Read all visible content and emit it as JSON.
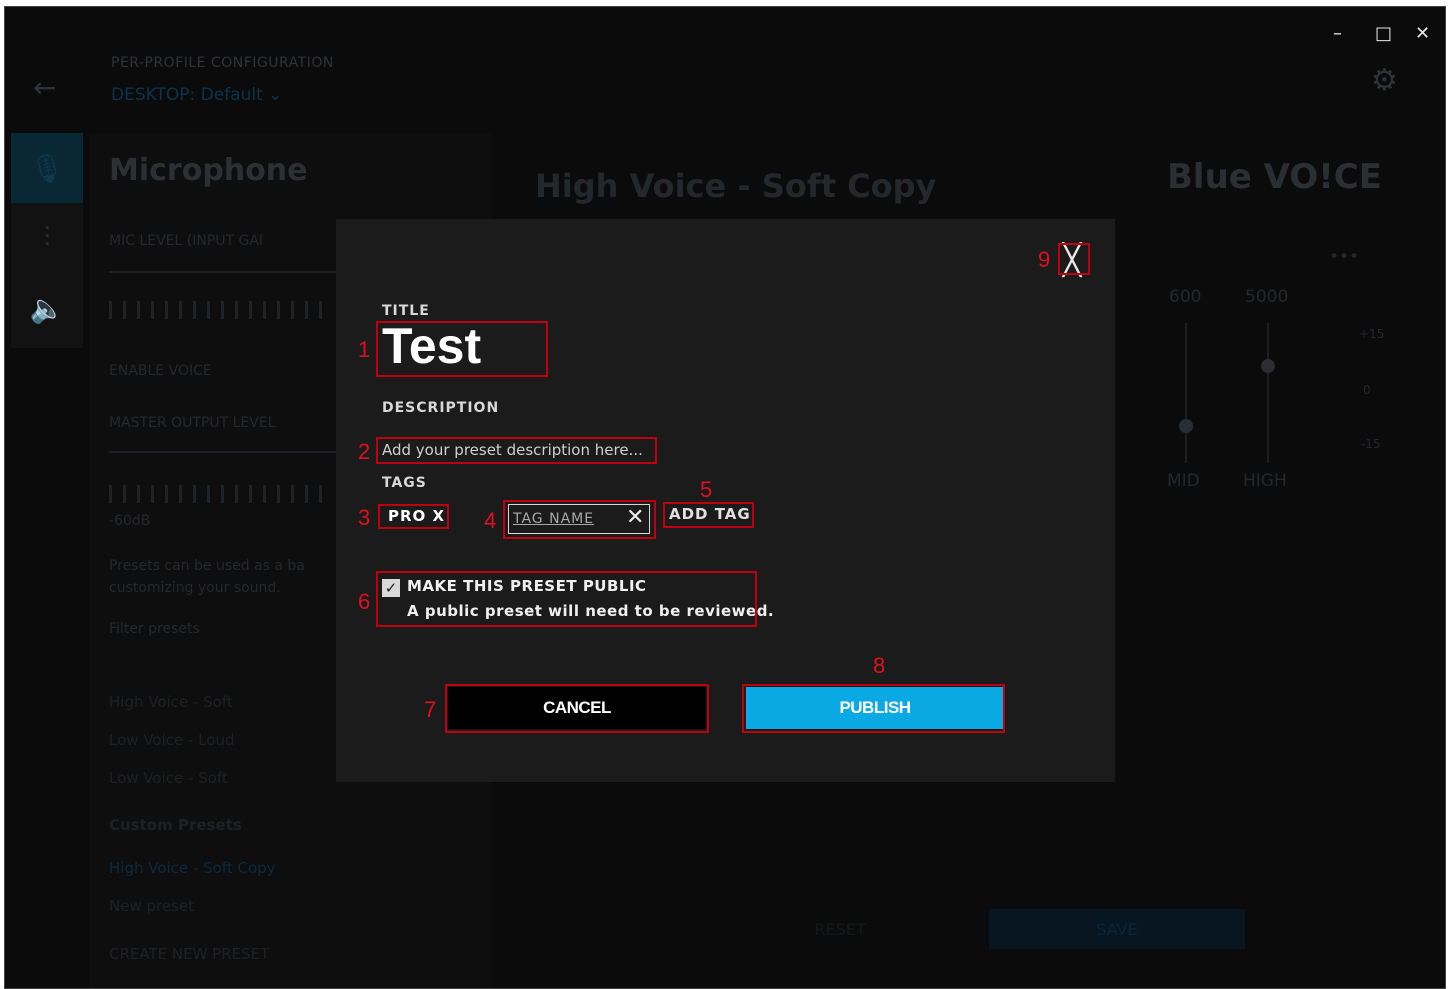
{
  "window": {
    "minimize_glyph": "–",
    "maximize_glyph": "□",
    "close_glyph": "✕"
  },
  "topbar": {
    "back_icon": "←",
    "config_label": "PER-PROFILE CONFIGURATION",
    "profile": "DESKTOP: Default",
    "profile_chevron": "⌄",
    "settings_icon": "⚙"
  },
  "rail": {
    "items": [
      {
        "icon": "mic-icon",
        "glyph": "🎙"
      },
      {
        "icon": "equalizer-icon",
        "glyph": "⫶"
      },
      {
        "icon": "speaker-icon",
        "glyph": "🔈"
      }
    ]
  },
  "left_panel": {
    "title": "Microphone",
    "mic_level": "MIC LEVEL (INPUT GAI",
    "enable_label": "ENABLE",
    "voice_label": "VOICE",
    "master_output": "MASTER OUTPUT LEVEL",
    "db_value": "-60dB",
    "presets_help": "Presets can be used as a ba",
    "presets_help_2": "customizing your sound.",
    "filter_placeholder": "Filter presets",
    "preset_items": [
      "High Voice - Soft",
      "Low Voice - Loud",
      "Low Voice - Soft"
    ],
    "custom_header": "Custom Presets",
    "custom_items": [
      "High Voice - Soft Copy",
      "New preset"
    ],
    "create_new": "CREATE NEW PRESET"
  },
  "main": {
    "title": "High Voice - Soft Copy",
    "logo_text": "Blue VO!CE",
    "more_icon": "•••",
    "eq_freqs": [
      "600",
      "5000"
    ],
    "eq_bands": [
      "MID",
      "HIGH"
    ],
    "eq_scale": [
      "+15",
      "0",
      "-15"
    ],
    "reset": "RESET",
    "save": "SAVE"
  },
  "modal": {
    "close_glyph": "╳",
    "title_label": "TITLE",
    "title_value": "Test",
    "description_label": "DESCRIPTION",
    "description_placeholder": "Add your preset description here...",
    "tags_label": "TAGS",
    "tag_chip": "PRO X",
    "tag_input_placeholder": "TAG NAME",
    "tag_clear_glyph": "✕",
    "add_tag": "ADD TAG",
    "public_checked": true,
    "public_label": "MAKE THIS PRESET PUBLIC",
    "public_note": "A public preset will need to be reviewed.",
    "cancel": "CANCEL",
    "publish": "PUBLISH",
    "publish_color": "#0aa9e4"
  },
  "annotations": [
    "1",
    "2",
    "3",
    "4",
    "5",
    "6",
    "7",
    "8",
    "9"
  ]
}
